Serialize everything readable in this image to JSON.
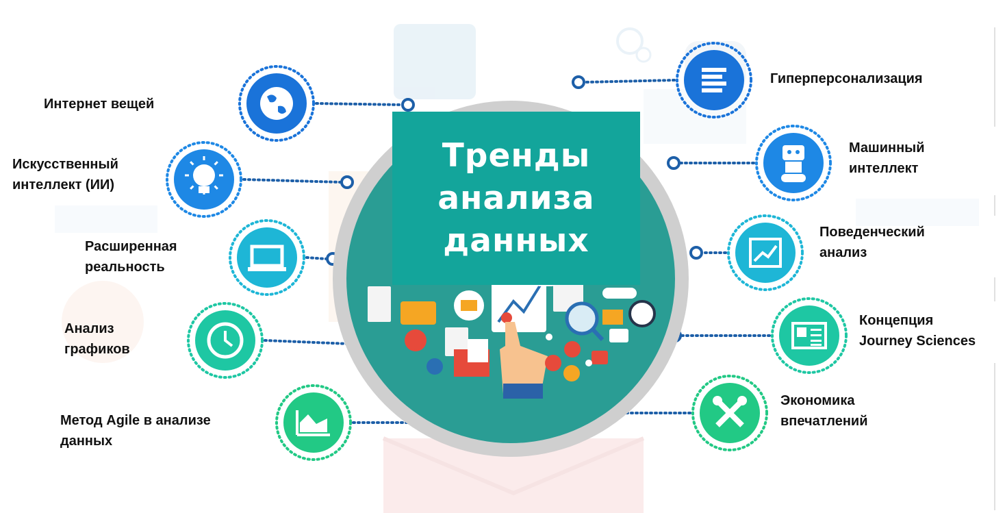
{
  "center": {
    "title_lines": [
      "Тренды",
      "анализа",
      "данных"
    ]
  },
  "left_nodes": [
    {
      "label_lines": [
        "Интернет вещей"
      ],
      "icon": "globe-icon",
      "color": "#1a73d9"
    },
    {
      "label_lines": [
        "Искусственный",
        "интеллект (ИИ)"
      ],
      "icon": "lightbulb-icon",
      "color": "#1e88e5"
    },
    {
      "label_lines": [
        "Расширенная",
        "реальность"
      ],
      "icon": "laptop-icon",
      "color": "#1eb6d6"
    },
    {
      "label_lines": [
        "Анализ",
        "графиков"
      ],
      "icon": "clock-icon",
      "color": "#1ec7a3"
    },
    {
      "label_lines": [
        "Метод Agile в анализе",
        "данных"
      ],
      "icon": "area-chart-icon",
      "color": "#22c985"
    }
  ],
  "right_nodes": [
    {
      "label_lines": [
        "Гиперперсонализация"
      ],
      "icon": "list-icon",
      "color": "#1a73d9"
    },
    {
      "label_lines": [
        "Машинный",
        "интеллект"
      ],
      "icon": "robot-icon",
      "color": "#1e88e5"
    },
    {
      "label_lines": [
        "Поведенческий",
        "анализ"
      ],
      "icon": "trend-chart-icon",
      "color": "#1eb6d6"
    },
    {
      "label_lines": [
        "Концепция",
        "Journey Sciences"
      ],
      "icon": "newspaper-icon",
      "color": "#1ec7a3"
    },
    {
      "label_lines": [
        "Экономика",
        "впечатлений"
      ],
      "icon": "tools-icon",
      "color": "#22c985"
    }
  ],
  "colors": {
    "title_box": "#13a59b",
    "hub_ring": "#c9c9c9",
    "hub_fill": "#2a9d94",
    "connector": "#1d5fa8"
  }
}
